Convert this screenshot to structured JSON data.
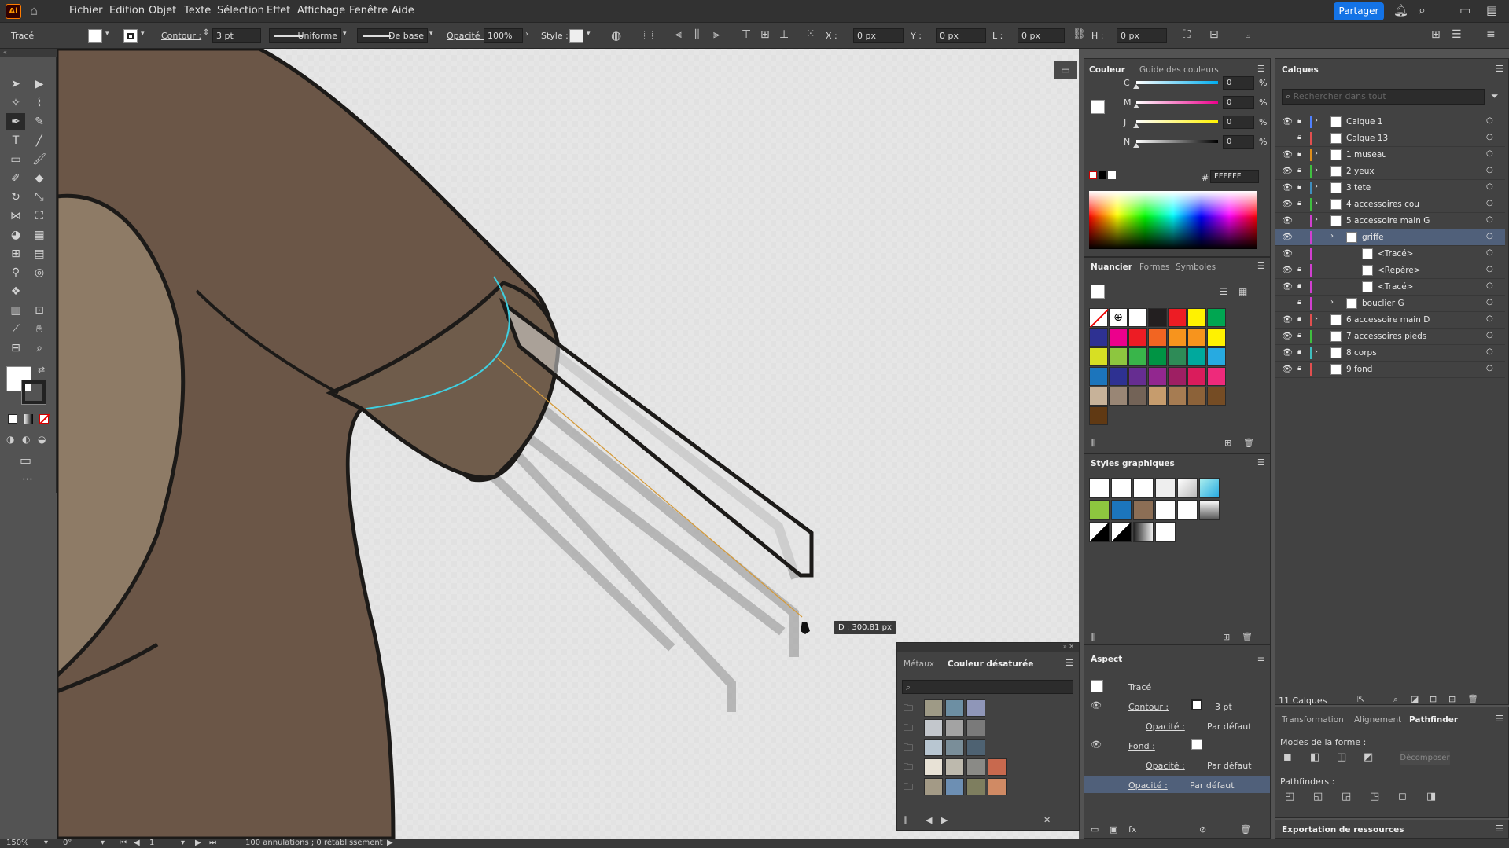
{
  "menubar": {
    "app_icon": "Ai",
    "home_icon": "home-icon",
    "items": [
      "Fichier",
      "Edition",
      "Objet",
      "Texte",
      "Sélection",
      "Effet",
      "Affichage",
      "Fenêtre",
      "Aide"
    ],
    "share_label": "Partager"
  },
  "control": {
    "object_type": "Tracé",
    "contour_label": "Contour :",
    "stroke_weight": "3 pt",
    "stroke_profile": "Uniforme",
    "brush": "De base",
    "opacity_label": "Opacité :",
    "opacity": "100%",
    "style_label": "Style :",
    "x_label": "X :",
    "x_value": "0 px",
    "y_label": "Y :",
    "y_value": "0 px",
    "w_label": "L :",
    "w_value": "0 px",
    "h_label": "H :",
    "h_value": "0 px"
  },
  "canvas": {
    "tooltip": "D : 300,81 px"
  },
  "color_panel": {
    "tab1": "Couleur",
    "tab2": "Guide des couleurs",
    "channels": [
      {
        "label": "C",
        "value": "0",
        "unit": "%"
      },
      {
        "label": "M",
        "value": "0",
        "unit": "%"
      },
      {
        "label": "J",
        "value": "0",
        "unit": "%"
      },
      {
        "label": "N",
        "value": "0",
        "unit": "%"
      }
    ],
    "hex_label": "#",
    "hex": "FFFFFF"
  },
  "swatches_panel": {
    "tab1": "Nuancier",
    "tab2": "Formes",
    "tab3": "Symboles",
    "colors": [
      "none",
      "registration",
      "#ffffff",
      "#231f20",
      "#ed1c24",
      "#fff200",
      "#00a651",
      "#2e3192",
      "#ec008c",
      "#ed1c24",
      "#f26522",
      "#f7941d",
      "#f7941d",
      "#fff200",
      "#d7df23",
      "#8dc63f",
      "#39b54a",
      "#009444",
      "#2e8b57",
      "#00a99d",
      "#27aae1",
      "#1c75bc",
      "#2e3192",
      "#662d91",
      "#92278f",
      "#9e1f63",
      "#da1c5c",
      "#ee2a7b",
      "#c7b299",
      "#998675",
      "#736357",
      "#c69c6d",
      "#a67c52",
      "#8c6239",
      "#754c24",
      "#603913"
    ]
  },
  "graphic_styles": {
    "title": "Styles graphiques"
  },
  "aspect_panel": {
    "title": "Aspect",
    "object": "Tracé",
    "contour_label": "Contour :",
    "contour_value": "3 pt",
    "opacity_label": "Opacité :",
    "opacity_value": "Par défaut",
    "fill_label": "Fond :",
    "opacity2_label": "Opacité :",
    "opacity2_value": "Par défaut",
    "opacity3_label": "Opacité :",
    "opacity3_value": "Par défaut"
  },
  "floating_panel": {
    "tab1": "Métaux",
    "tab2": "Couleur désaturée",
    "rows": [
      [
        "#9e9a86",
        "#6d8fa3",
        "#8f96b8"
      ],
      [
        "#c3c7cc",
        "#a3a3a3",
        "#7a7a7a"
      ],
      [
        "#b8c6d1",
        "#7a8e99",
        "#4e6272"
      ],
      [
        "#e8e2d6",
        "#bdb9ad",
        "#8a8a86",
        "#c8694e"
      ],
      [
        "#a39a86",
        "#6d8fb3",
        "#7e7e5f",
        "#d08a64"
      ]
    ]
  },
  "layers_panel": {
    "title": "Calques",
    "search_placeholder": "Rechercher dans tout",
    "layers": [
      {
        "name": "Calque 1",
        "color": "#4f80ff",
        "eye": true,
        "lock": true,
        "indent": 0,
        "expand": true
      },
      {
        "name": "Calque 13",
        "color": "#e24f4f",
        "eye": false,
        "lock": true,
        "indent": 0,
        "expand": false
      },
      {
        "name": "1 museau",
        "color": "#e08e1b",
        "eye": true,
        "lock": true,
        "indent": 0,
        "expand": true
      },
      {
        "name": "2 yeux",
        "color": "#3fbf3f",
        "eye": true,
        "lock": true,
        "indent": 0,
        "expand": true
      },
      {
        "name": "3 tete",
        "color": "#3f8fbf",
        "eye": true,
        "lock": true,
        "indent": 0,
        "expand": true
      },
      {
        "name": "4 accessoires cou",
        "color": "#3fbf3f",
        "eye": true,
        "lock": true,
        "indent": 0,
        "expand": true
      },
      {
        "name": "5 accessoire main G",
        "color": "#d13fd1",
        "eye": true,
        "lock": false,
        "indent": 0,
        "expand": true
      },
      {
        "name": "griffe",
        "color": "#d13fd1",
        "eye": true,
        "lock": false,
        "indent": 1,
        "expand": true,
        "selected": true
      },
      {
        "name": "<Tracé>",
        "color": "#d13fd1",
        "eye": true,
        "lock": false,
        "indent": 2,
        "expand": false
      },
      {
        "name": "<Repère>",
        "color": "#d13fd1",
        "eye": true,
        "lock": true,
        "indent": 2,
        "expand": false
      },
      {
        "name": "<Tracé>",
        "color": "#d13fd1",
        "eye": true,
        "lock": true,
        "indent": 2,
        "expand": false
      },
      {
        "name": "bouclier G",
        "color": "#d13fd1",
        "eye": false,
        "lock": true,
        "indent": 1,
        "expand": true
      },
      {
        "name": "6 accessoire main D",
        "color": "#e24f4f",
        "eye": true,
        "lock": true,
        "indent": 0,
        "expand": true
      },
      {
        "name": "7 accessoires pieds",
        "color": "#3fbf3f",
        "eye": true,
        "lock": true,
        "indent": 0,
        "expand": false
      },
      {
        "name": "8 corps",
        "color": "#3fbfbf",
        "eye": true,
        "lock": true,
        "indent": 0,
        "expand": true
      },
      {
        "name": "9 fond",
        "color": "#e24f4f",
        "eye": true,
        "lock": true,
        "indent": 0,
        "expand": false
      }
    ],
    "count": "11 Calques"
  },
  "pathfinder_panel": {
    "tab1": "Transformation",
    "tab2": "Alignement",
    "tab3": "Pathfinder",
    "modes_label": "Modes de la forme :",
    "expand_label": "Décomposer",
    "pathfinders_label": "Pathfinders :"
  },
  "export_panel": {
    "title": "Exportation de ressources"
  },
  "status": {
    "zoom": "150%",
    "rotation": "0°",
    "artboard": "1",
    "history": "100 annulations ; 0 rétablissement"
  }
}
